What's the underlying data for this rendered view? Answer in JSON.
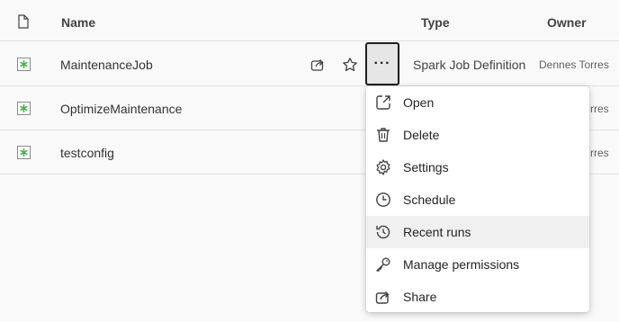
{
  "header": {
    "file_icon": "document-icon",
    "name_label": "Name",
    "type_label": "Type",
    "owner_label": "Owner"
  },
  "rows": [
    {
      "icon": "spark-job-icon",
      "name": "MaintenanceJob",
      "type": "Spark Job Definition",
      "owner": "Dennes Torres"
    },
    {
      "icon": "spark-job-icon",
      "name": "OptimizeMaintenance",
      "owner_partial": "rres"
    },
    {
      "icon": "spark-job-icon",
      "name": "testconfig",
      "owner_partial": "rres"
    }
  ],
  "row_actions": {
    "share_icon": "share-icon",
    "favorite_icon": "star-icon",
    "more_label": "···"
  },
  "menu": {
    "items": [
      {
        "label": "Open",
        "icon": "open-external-icon"
      },
      {
        "label": "Delete",
        "icon": "trash-icon"
      },
      {
        "label": "Settings",
        "icon": "gear-icon"
      },
      {
        "label": "Schedule",
        "icon": "clock-icon"
      },
      {
        "label": "Recent runs",
        "icon": "history-icon",
        "highlighted": true
      },
      {
        "label": "Manage permissions",
        "icon": "key-icon"
      },
      {
        "label": "Share",
        "icon": "share-icon"
      }
    ]
  },
  "colors": {
    "spark_icon": "#4caf50",
    "highlight": "#f0f0f0",
    "border": "#e1e1e1"
  }
}
